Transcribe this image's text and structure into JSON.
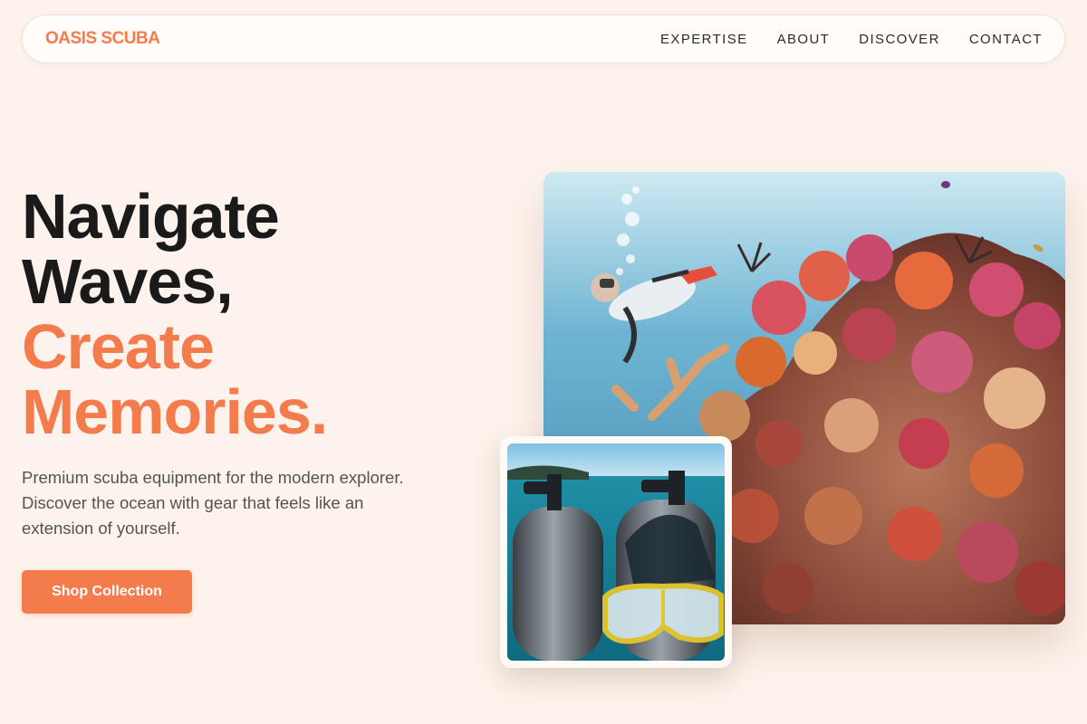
{
  "brand": {
    "name": "OASIS SCUBA",
    "color": "#f47c4c"
  },
  "nav": {
    "links": [
      "EXPERTISE",
      "ABOUT",
      "DISCOVER",
      "CONTACT"
    ]
  },
  "hero": {
    "headline": {
      "line1": "Navigate",
      "line2": "Waves,",
      "line3": "Create",
      "line4": "Memories."
    },
    "subtext": "Premium scuba equipment for the modern explorer. Discover the ocean with gear that feels like an extension of yourself.",
    "cta_label": "Shop Collection"
  },
  "images": {
    "main": {
      "alt": "Diver swimming beside a colorful coral reef"
    },
    "secondary": {
      "alt": "Scuba tanks and yellow dive mask by the sea"
    }
  },
  "colors": {
    "background": "#fdf3ec",
    "accent": "#f47c4c",
    "text": "#1a1a1a"
  }
}
